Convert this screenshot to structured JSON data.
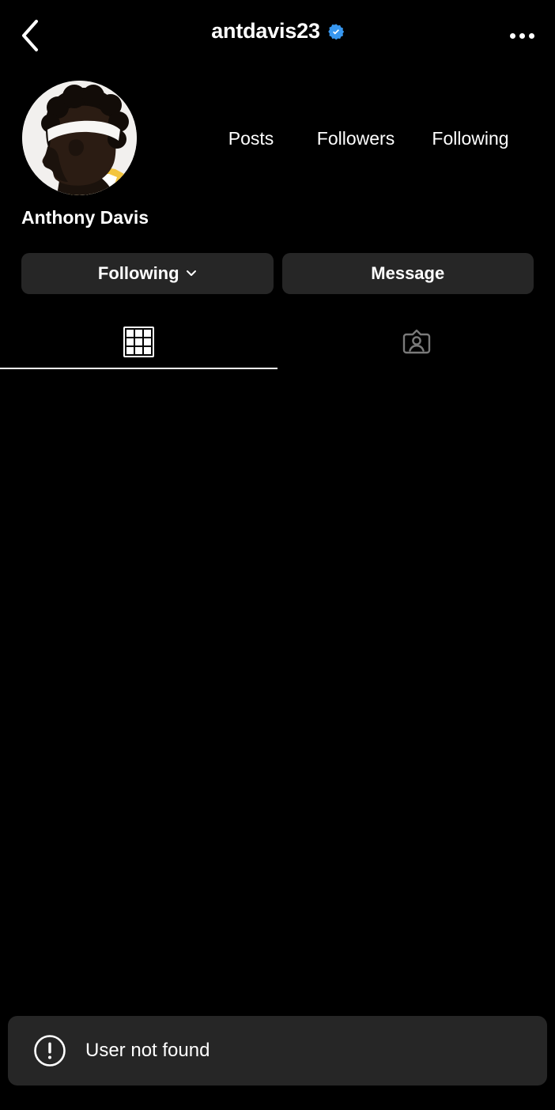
{
  "app": {
    "background_color": "#000000",
    "surface_color": "#262626",
    "accent_color": "#3797F0",
    "text_color": "#FFFFFF"
  },
  "topbar": {
    "back_icon": "chevron-left-icon",
    "username": "antdavis23",
    "verified_icon": "verified-badge-icon",
    "more_icon": "more-options-icon"
  },
  "profile": {
    "avatar_icon": "profile-avatar-photo",
    "full_name": "Anthony Davis",
    "stats": [
      {
        "label": "Posts",
        "value": ""
      },
      {
        "label": "Followers",
        "value": ""
      },
      {
        "label": "Following",
        "value": ""
      }
    ]
  },
  "actions": {
    "following_label": "Following",
    "following_chevron_icon": "chevron-down-icon",
    "message_label": "Message"
  },
  "tabs": [
    {
      "name": "grid",
      "icon": "grid-icon",
      "active": true
    },
    {
      "name": "tagged",
      "icon": "tagged-person-icon",
      "active": false
    }
  ],
  "toast": {
    "icon": "error-exclamation-icon",
    "message": "User not found"
  }
}
